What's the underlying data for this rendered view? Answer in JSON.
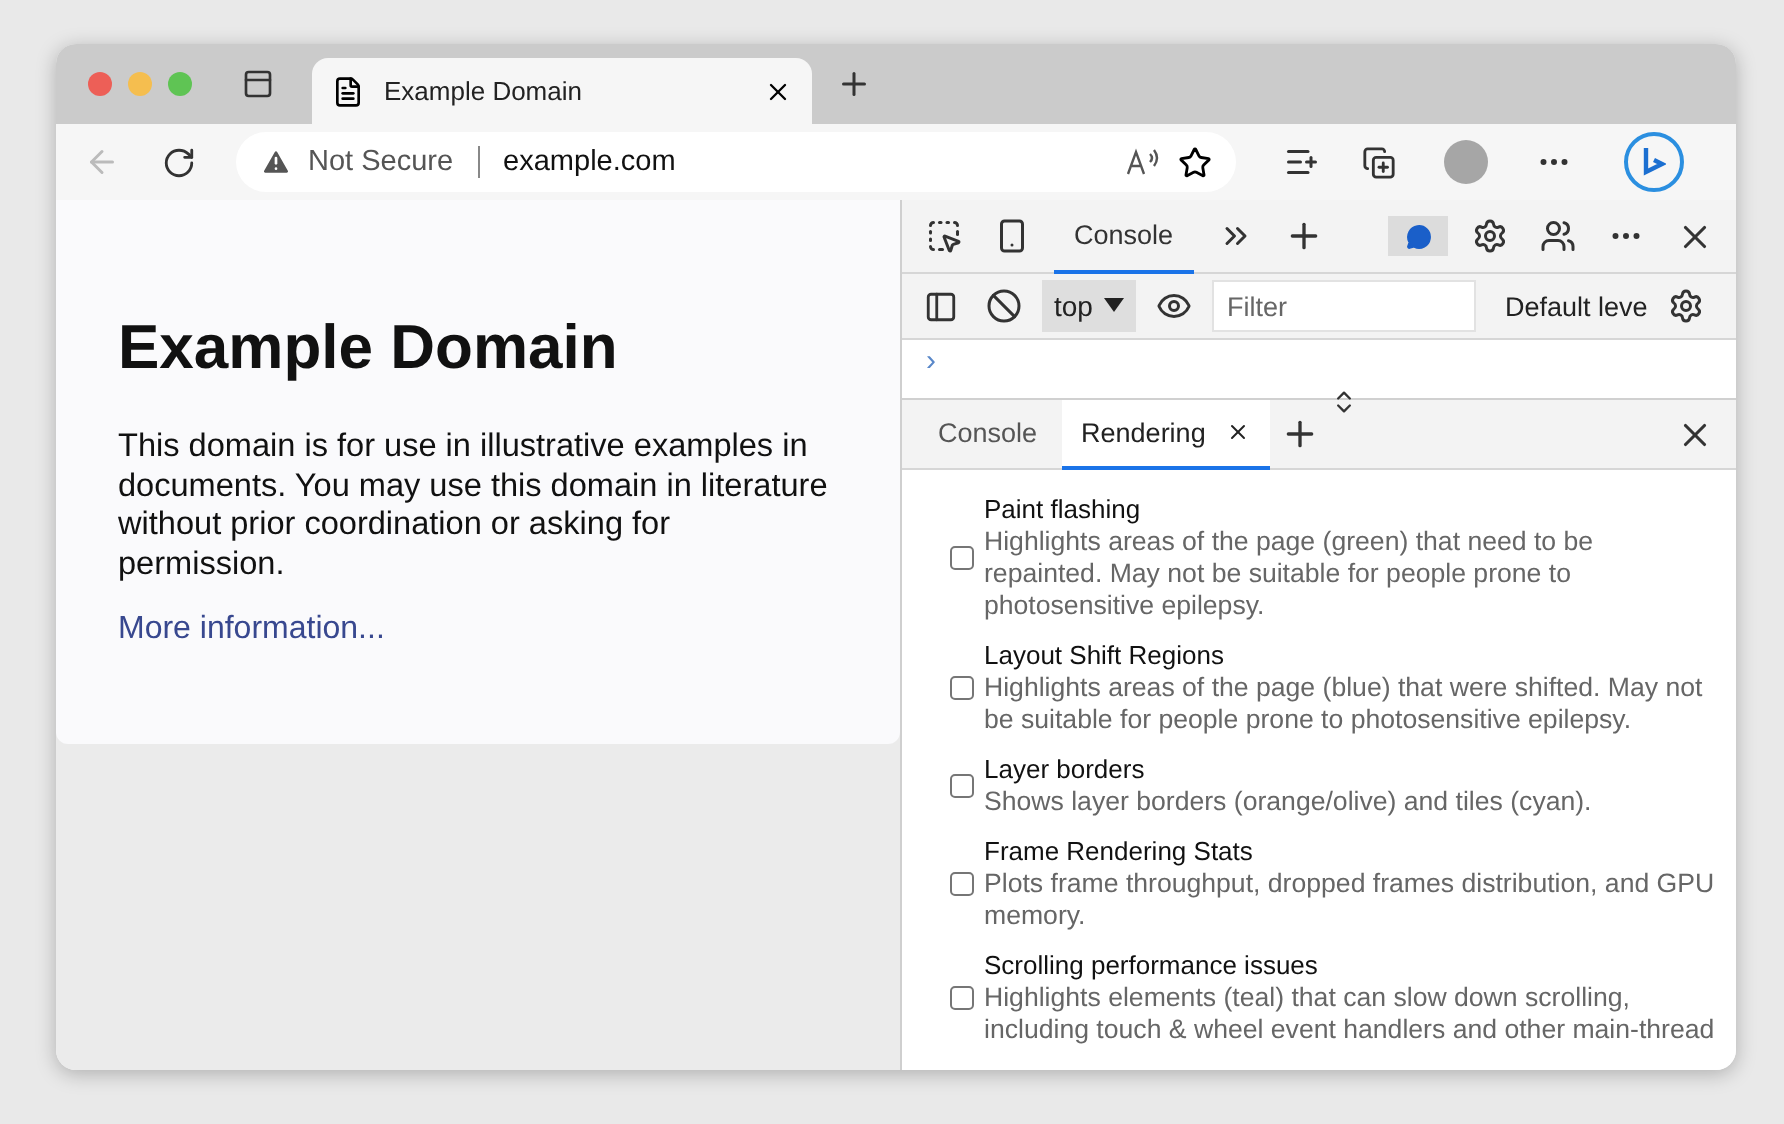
{
  "browser_tab": {
    "title": "Example Domain"
  },
  "address_bar": {
    "security": "Not Secure",
    "url": "example.com"
  },
  "page": {
    "heading": "Example Domain",
    "paragraph": "This domain is for use in illustrative examples in documents. You may use this domain in literature without prior coordination or asking for permission.",
    "link": "More information..."
  },
  "devtools": {
    "tabs": [
      {
        "label": "Console",
        "selected": true
      }
    ],
    "context": "top",
    "filter_placeholder": "Filter",
    "levels": "Default leve",
    "prompt": "›",
    "drawer_tabs": [
      {
        "label": "Console",
        "selected": false,
        "closable": false
      },
      {
        "label": "Rendering",
        "selected": true,
        "closable": true
      }
    ],
    "rendering_options": [
      {
        "title": "Paint flashing",
        "description": "Highlights areas of the page (green) that need to be repainted. May not be suitable for people prone to photosensitive epilepsy.",
        "checked": false
      },
      {
        "title": "Layout Shift Regions",
        "description": "Highlights areas of the page (blue) that were shifted. May not be suitable for people prone to photosensitive epilepsy.",
        "checked": false
      },
      {
        "title": "Layer borders",
        "description": "Shows layer borders (orange/olive) and tiles (cyan).",
        "checked": false
      },
      {
        "title": "Frame Rendering Stats",
        "description": "Plots frame throughput, dropped frames distribution, and GPU memory.",
        "checked": false
      },
      {
        "title": "Scrolling performance issues",
        "description": "Highlights elements (teal) that can slow down scrolling, including touch & wheel event handlers and other main-thread",
        "checked": false
      }
    ]
  }
}
